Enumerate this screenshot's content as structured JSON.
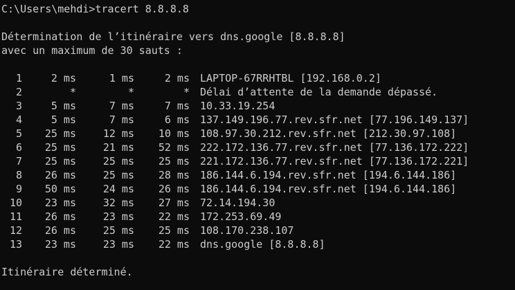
{
  "window": {
    "background": "#0c0c0c",
    "foreground": "#cccccc"
  },
  "console": {
    "prompt_command": "C:\\Users\\mehdi>tracert 8.8.8.8",
    "header_line1": "Détermination de l’itinéraire vers dns.google [8.8.8.8]",
    "header_line2": "avec un maximum de 30 sauts :",
    "hops": [
      {
        "num": "1",
        "r1": "2 ms",
        "r2": "1 ms",
        "r3": "2 ms",
        "host": "LAPTOP-67RRHTBL [192.168.0.2]"
      },
      {
        "num": "2",
        "r1": "*",
        "r2": "*",
        "r3": "*",
        "host": "Délai d’attente de la demande dépassé."
      },
      {
        "num": "3",
        "r1": "5 ms",
        "r2": "7 ms",
        "r3": "7 ms",
        "host": "10.33.19.254"
      },
      {
        "num": "4",
        "r1": "5 ms",
        "r2": "7 ms",
        "r3": "6 ms",
        "host": "137.149.196.77.rev.sfr.net [77.196.149.137]"
      },
      {
        "num": "5",
        "r1": "25 ms",
        "r2": "12 ms",
        "r3": "10 ms",
        "host": "108.97.30.212.rev.sfr.net [212.30.97.108]"
      },
      {
        "num": "6",
        "r1": "25 ms",
        "r2": "21 ms",
        "r3": "52 ms",
        "host": "222.172.136.77.rev.sfr.net [77.136.172.222]"
      },
      {
        "num": "7",
        "r1": "25 ms",
        "r2": "25 ms",
        "r3": "25 ms",
        "host": "221.172.136.77.rev.sfr.net [77.136.172.221]"
      },
      {
        "num": "8",
        "r1": "26 ms",
        "r2": "25 ms",
        "r3": "28 ms",
        "host": "186.144.6.194.rev.sfr.net [194.6.144.186]"
      },
      {
        "num": "9",
        "r1": "50 ms",
        "r2": "24 ms",
        "r3": "26 ms",
        "host": "186.144.6.194.rev.sfr.net [194.6.144.186]"
      },
      {
        "num": "10",
        "r1": "23 ms",
        "r2": "32 ms",
        "r3": "27 ms",
        "host": "72.14.194.30"
      },
      {
        "num": "11",
        "r1": "26 ms",
        "r2": "23 ms",
        "r3": "22 ms",
        "host": "172.253.69.49"
      },
      {
        "num": "12",
        "r1": "26 ms",
        "r2": "25 ms",
        "r3": "25 ms",
        "host": "108.170.238.107"
      },
      {
        "num": "13",
        "r1": "23 ms",
        "r2": "23 ms",
        "r3": "22 ms",
        "host": "dns.google [8.8.8.8]"
      }
    ],
    "footer": "Itinéraire déterminé."
  }
}
